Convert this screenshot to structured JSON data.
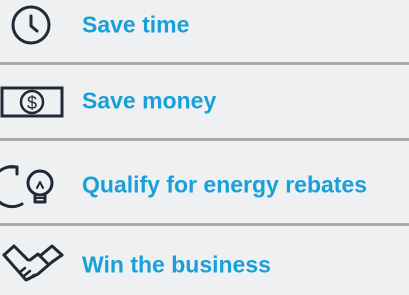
{
  "benefits": [
    {
      "icon": "clock-icon",
      "label": "Save time"
    },
    {
      "icon": "dollar-bill-icon",
      "label": "Save money"
    },
    {
      "icon": "lightbulb-cycle-icon",
      "label": "Qualify for energy rebates"
    },
    {
      "icon": "handshake-icon",
      "label": "Win the business"
    }
  ],
  "colors": {
    "accent": "#1aa0d8",
    "icon_stroke": "#1f2a35",
    "divider": "#a9acaf",
    "background": "#eef0f2"
  }
}
